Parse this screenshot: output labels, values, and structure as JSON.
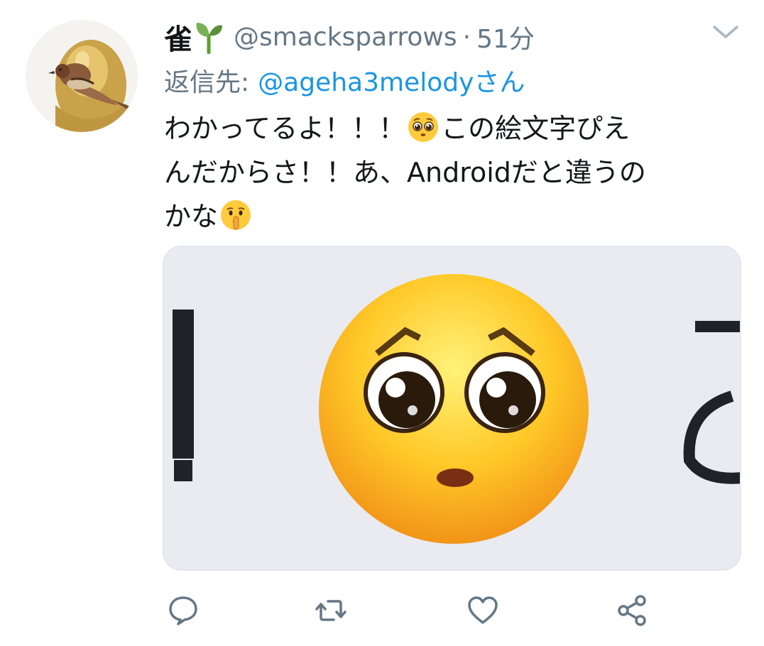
{
  "tweet": {
    "display_name": "雀",
    "name_emoji": "seedling-icon",
    "handle": "@smacksparrows",
    "separator": "·",
    "time": "51分",
    "reply_prefix": "返信先:",
    "reply_to": "@ageha3melodyさん",
    "text_lines": [
      [
        "わかってるよ！！！",
        "この絵文字ぴえ"
      ],
      [
        "んだからさ！！あ、Androidだと違うの"
      ],
      [
        "かな"
      ]
    ],
    "inline_emojis": [
      "pleading-face-emoji",
      "shushing-face-emoji"
    ],
    "media": "pleading-face-zoomed-image"
  },
  "actions": {
    "reply": "reply-icon",
    "retweet": "retweet-icon",
    "like": "like-icon",
    "share": "share-icon"
  },
  "colors": {
    "primary_text": "#14171a",
    "secondary_text": "#657786",
    "link": "#1b95e0",
    "icon": "#657786",
    "border": "#e1e8ed"
  }
}
